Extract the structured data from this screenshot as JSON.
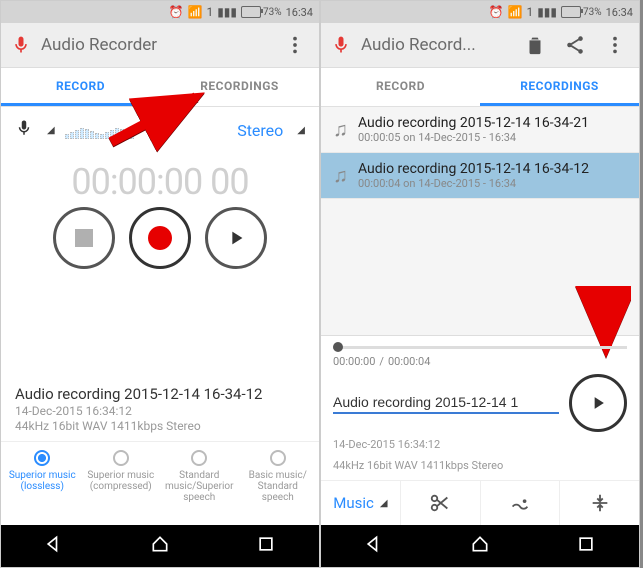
{
  "statusbar": {
    "battery": "73%",
    "time": "16:34",
    "sim": "1"
  },
  "left": {
    "title": "Audio Recorder",
    "tabs": {
      "record": "RECORD",
      "recordings": "RECORDINGS",
      "active": "record"
    },
    "channel": "Stereo",
    "timer": "00:00:00 00",
    "info": {
      "name": "Audio recording 2015-12-14 16-34-12",
      "date": "14-Dec-2015 16:34:12",
      "format": "44kHz 16bit WAV 1411kbps Stereo"
    },
    "presets": [
      {
        "label": "Superior music (lossless)",
        "checked": true
      },
      {
        "label": "Superior music (compressed)",
        "checked": false
      },
      {
        "label": "Standard music/Superior speech",
        "checked": false
      },
      {
        "label": "Basic music/ Standard speech",
        "checked": false
      }
    ]
  },
  "right": {
    "title": "Audio Record...",
    "tabs": {
      "record": "RECORD",
      "recordings": "RECORDINGS",
      "active": "recordings"
    },
    "list": [
      {
        "name": "Audio recording 2015-12-14 16-34-21",
        "meta": "00:00:05 on 14-Dec-2015 - 16:34",
        "selected": false
      },
      {
        "name": "Audio recording 2015-12-14 16-34-12",
        "meta": "00:00:04 on 14-Dec-2015 - 16:34",
        "selected": true
      }
    ],
    "player": {
      "pos": "00:00:00",
      "dur": "00:00:04",
      "sep": " / ",
      "name": "Audio recording 2015-12-14 1",
      "date": "14-Dec-2015 16:34:12",
      "format": "44kHz 16bit WAV 1411kbps Stereo",
      "music": "Music"
    }
  }
}
